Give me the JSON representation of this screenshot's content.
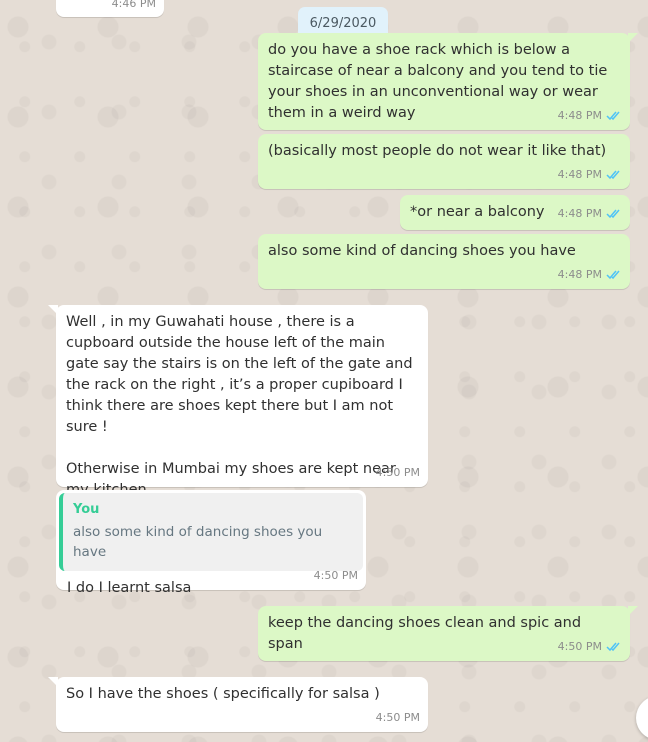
{
  "date_chip": "6/29/2020",
  "messages": [
    {
      "text": "",
      "time": "4:46 PM"
    },
    {
      "text": "do you have a shoe rack which is below a staircase of near a balcony and you tend to tie your shoes in an unconventional way or wear them in a weird way",
      "time": "4:48 PM"
    },
    {
      "text": "(basically most people do not wear it like that)",
      "time": "4:48 PM"
    },
    {
      "text": "*or near a balcony",
      "time": "4:48 PM"
    },
    {
      "text": "also some kind of dancing shoes you have",
      "time": "4:48 PM"
    },
    {
      "text": "Well , in my Guwahati house , there is a cupboard outside the house left of the main gate say the stairs is on the left of the gate and the rack on the right , it’s a proper cupiboard I think there are shoes kept there but I am not sure !\n\nOtherwise in Mumbai my shoes are kept near my kitchen",
      "time": "4:50 PM"
    },
    {
      "quote_author": "You",
      "quote_text": "also some kind of dancing shoes you have",
      "text": "I do I learnt salsa",
      "time": "4:50 PM"
    },
    {
      "text": "keep the dancing shoes clean and spic and span",
      "time": "4:50 PM"
    },
    {
      "text": "So I have the shoes ( specifically for salsa )",
      "time": "4:50 PM"
    }
  ],
  "colors": {
    "background": "#e5ddd5",
    "outgoing_bubble": "#dcf8c6",
    "incoming_bubble": "#ffffff",
    "read_ticks": "#4fc3f7",
    "quote_accent": "#35cd96",
    "date_chip": "#e1f2fb"
  },
  "icons": {
    "read_receipt": "double-check-icon"
  }
}
